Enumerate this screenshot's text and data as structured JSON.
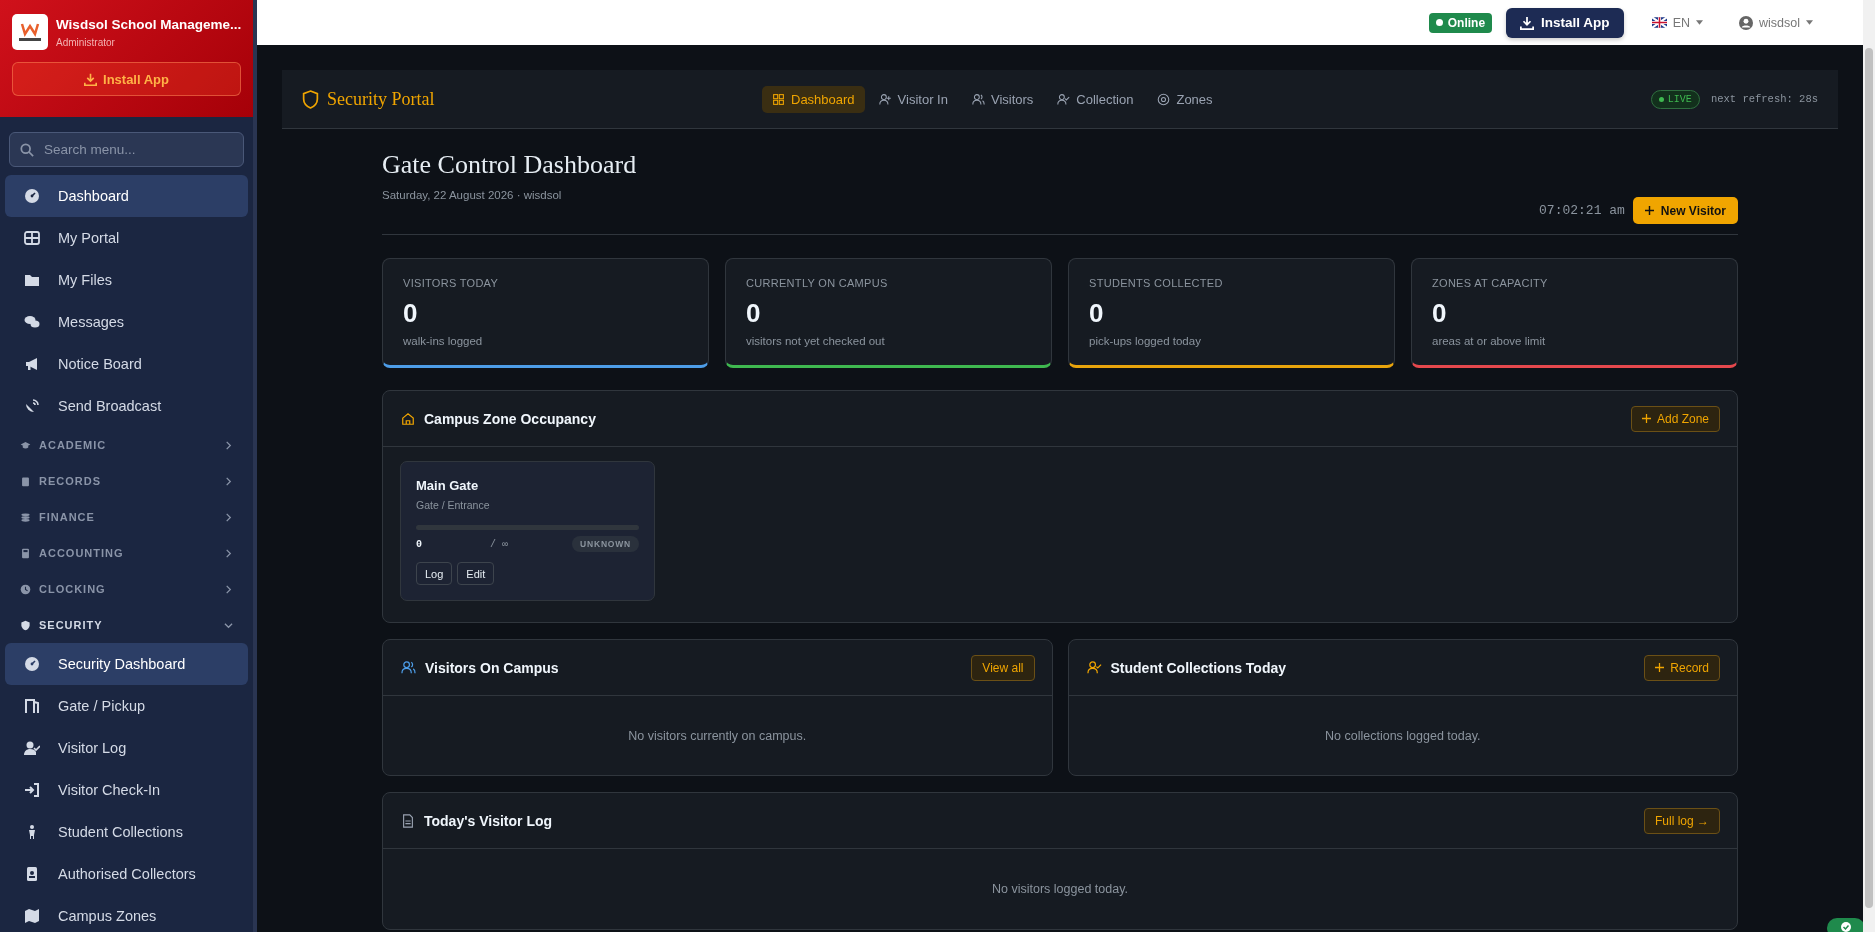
{
  "sidebar": {
    "app_name": "Wisdsol School Manageme...",
    "role": "Administrator",
    "install_button": "Install App",
    "search": {
      "placeholder": "Search menu..."
    },
    "menu": [
      {
        "kind": "link",
        "label": "Dashboard",
        "selected": true
      },
      {
        "kind": "link",
        "label": "My Portal",
        "selected": false
      },
      {
        "kind": "link",
        "label": "My Files",
        "selected": false
      },
      {
        "kind": "link",
        "label": "Messages",
        "selected": false
      },
      {
        "kind": "link",
        "label": "Notice Board",
        "selected": false
      },
      {
        "kind": "link",
        "label": "Send Broadcast",
        "selected": false
      },
      {
        "kind": "group",
        "label": "ACADEMIC",
        "expanded": false
      },
      {
        "kind": "group",
        "label": "RECORDS",
        "expanded": false
      },
      {
        "kind": "group",
        "label": "FINANCE",
        "expanded": false
      },
      {
        "kind": "group",
        "label": "ACCOUNTING",
        "expanded": false
      },
      {
        "kind": "group",
        "label": "CLOCKING",
        "expanded": false
      },
      {
        "kind": "group",
        "label": "SECURITY",
        "expanded": true,
        "children": [
          {
            "label": "Security Dashboard",
            "selected": true
          },
          {
            "label": "Gate / Pickup",
            "selected": false
          },
          {
            "label": "Visitor Log",
            "selected": false
          },
          {
            "label": "Visitor Check-In",
            "selected": false
          },
          {
            "label": "Student Collections",
            "selected": false
          },
          {
            "label": "Authorised Collectors",
            "selected": false
          },
          {
            "label": "Campus Zones",
            "selected": false
          }
        ]
      }
    ]
  },
  "topbar": {
    "status": "Online",
    "install_button": "Install App",
    "language": "EN",
    "user": "wisdsol"
  },
  "portal": {
    "title": "Security Portal",
    "tabs": [
      {
        "label": "Dashboard",
        "selected": true
      },
      {
        "label": "Visitor In",
        "selected": false
      },
      {
        "label": "Visitors",
        "selected": false
      },
      {
        "label": "Collection",
        "selected": false
      },
      {
        "label": "Zones",
        "selected": false
      }
    ],
    "live_badge": "LIVE",
    "refresh": "next refresh: 28s"
  },
  "page": {
    "title": "Gate Control Dashboard",
    "subtitle": "Saturday, 22 August 2026 · wisdsol",
    "clock": "07:02:21 am",
    "new_visitor_button": "New Visitor"
  },
  "stats": [
    {
      "label": "VISITORS TODAY",
      "value": "0",
      "note": "walk-ins logged",
      "color": "#4d9de8"
    },
    {
      "label": "CURRENTLY ON CAMPUS",
      "value": "0",
      "note": "visitors not yet checked out",
      "color": "#3fb950"
    },
    {
      "label": "STUDENTS COLLECTED",
      "value": "0",
      "note": "pick-ups logged today",
      "color": "#e8a40c"
    },
    {
      "label": "ZONES AT CAPACITY",
      "value": "0",
      "note": "areas at or above limit",
      "color": "#e5484d"
    }
  ],
  "zones_panel": {
    "title": "Campus Zone Occupancy",
    "button": "Add Zone",
    "zones": [
      {
        "name": "Main Gate",
        "type": "Gate / Entrance",
        "level": 0,
        "count": "0",
        "capacity": "/ ∞",
        "status": "UNKNOWN",
        "buttons": [
          "Log",
          "Edit"
        ]
      }
    ]
  },
  "visitors_panel": {
    "title": "Visitors On Campus",
    "button": "View all",
    "empty": "No visitors currently on campus."
  },
  "collections_panel": {
    "title": "Student Collections Today",
    "button": "Record",
    "empty": "No collections logged today."
  },
  "log_panel": {
    "title": "Today's Visitor Log",
    "button": "Full log →",
    "empty": "No visitors logged today."
  }
}
